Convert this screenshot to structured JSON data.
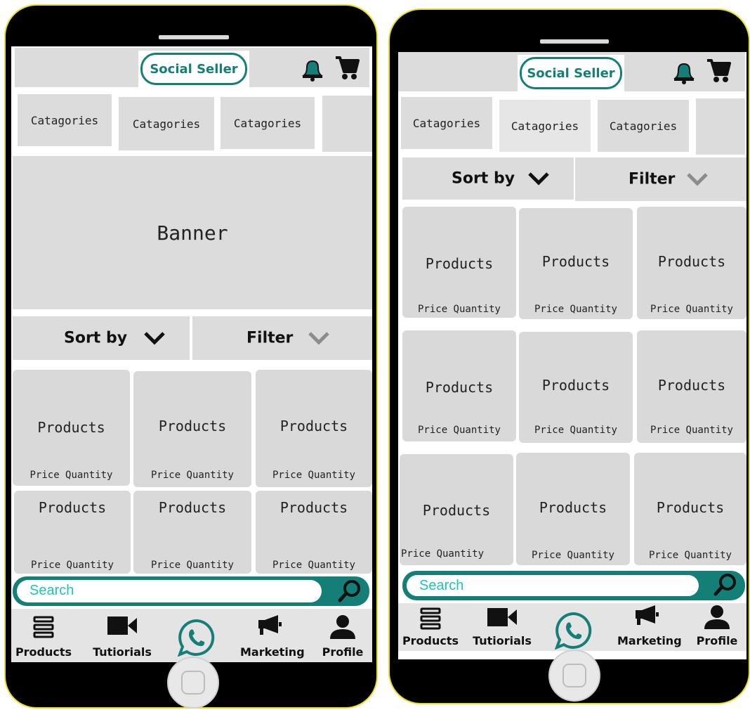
{
  "phones": [
    {
      "app": {
        "logo_text": "Social Seller"
      },
      "categories": [
        "Catagories",
        "Catagories",
        "Catagories",
        ""
      ],
      "banner": "Banner",
      "sort_label": "Sort by",
      "filter_label": "Filter",
      "products": [
        {
          "title": "Products",
          "meta": "Price Quantity"
        },
        {
          "title": "Products",
          "meta": "Price Quantity"
        },
        {
          "title": "Products",
          "meta": "Price Quantity"
        },
        {
          "title": "Products",
          "meta": "Price Quantity"
        },
        {
          "title": "Products",
          "meta": "Price Quantity"
        },
        {
          "title": "Products",
          "meta": "Price Quantity"
        }
      ],
      "search_placeholder": "Search",
      "nav": [
        "Products",
        "Tutiorials",
        "Marketing",
        "Profile"
      ]
    },
    {
      "app": {
        "logo_text": "Social Seller"
      },
      "categories": [
        "Catagories",
        "Catagories",
        "Catagories",
        ""
      ],
      "sort_label": "Sort by",
      "filter_label": "Filter",
      "products": [
        {
          "title": "Products",
          "meta": "Price Quantity"
        },
        {
          "title": "Products",
          "meta": "Price Quantity"
        },
        {
          "title": "Products",
          "meta": "Price Quantity"
        },
        {
          "title": "Products",
          "meta": "Price Quantity"
        },
        {
          "title": "Products",
          "meta": "Price Quantity"
        },
        {
          "title": "Products",
          "meta": "Price Quantity"
        },
        {
          "title": "Products",
          "meta": "Price Quantity"
        },
        {
          "title": "Products",
          "meta": "Price Quantity"
        },
        {
          "title": "Products",
          "meta": "Price Quantity"
        }
      ],
      "search_placeholder": "Search",
      "nav": [
        "Products",
        "Tutiorials",
        "Marketing",
        "Profile"
      ]
    }
  ],
  "icons": {
    "bell": "bell-icon",
    "cart": "cart-icon",
    "sort_chevron": "chevron-down-icon",
    "filter_chevron": "chevron-down-icon",
    "search": "magnifier-icon",
    "nav_products": "list-icon",
    "nav_tutorials": "video-camera-icon",
    "nav_whatsapp": "whatsapp-icon",
    "nav_marketing": "megaphone-icon",
    "nav_profile": "person-icon"
  },
  "colors": {
    "brand_teal": "#137f77",
    "search_text": "#1cc6b8",
    "panel_gray": "#dcdcdc",
    "phone_border": "#e8e020"
  }
}
